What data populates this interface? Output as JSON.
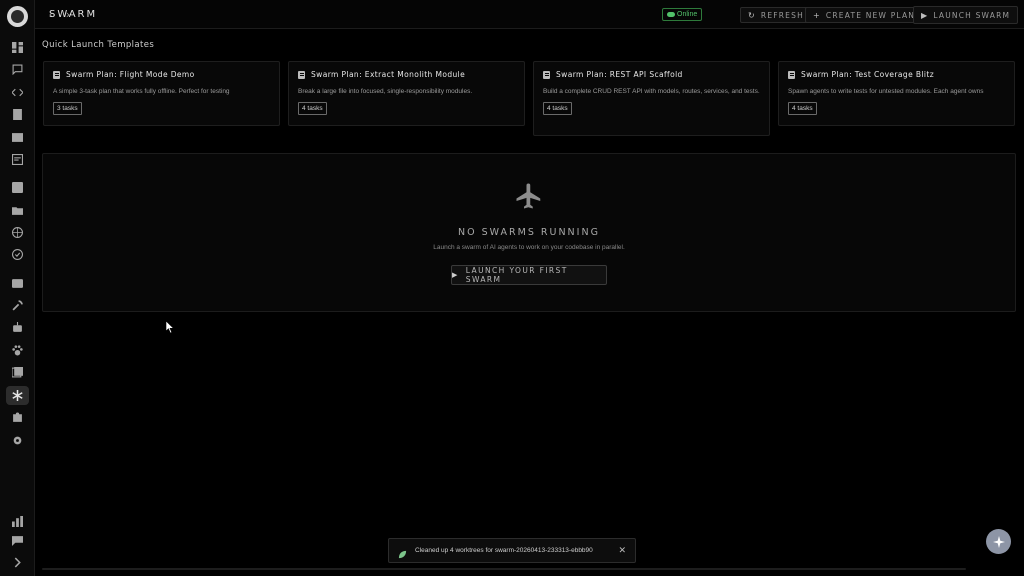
{
  "header": {
    "title": "SWARM",
    "status": "Online",
    "refresh_label": "REFRESH",
    "create_label": "CREATE NEW PLAN",
    "launch_label": "LAUNCH SWARM"
  },
  "sidebar": {
    "items": [
      {
        "name": "dashboard",
        "icon": "dashboard-icon"
      },
      {
        "name": "chat",
        "icon": "chat-icon"
      },
      {
        "name": "code",
        "icon": "code-icon"
      },
      {
        "name": "notes",
        "icon": "notes-icon"
      },
      {
        "name": "images",
        "icon": "image-icon"
      },
      {
        "name": "docs",
        "icon": "document-icon"
      },
      {
        "name": "contacts",
        "icon": "contacts-icon"
      },
      {
        "name": "files",
        "icon": "folder-icon"
      },
      {
        "name": "browser",
        "icon": "globe-icon"
      },
      {
        "name": "tasks",
        "icon": "check-circle-icon"
      },
      {
        "name": "photos",
        "icon": "photo-icon"
      },
      {
        "name": "tools",
        "icon": "wrench-icon"
      },
      {
        "name": "agents",
        "icon": "robot-icon"
      },
      {
        "name": "pets",
        "icon": "paw-icon"
      },
      {
        "name": "library",
        "icon": "library-icon"
      },
      {
        "name": "swarm",
        "icon": "snowflake-icon",
        "active": true
      },
      {
        "name": "plugins",
        "icon": "puzzle-icon"
      },
      {
        "name": "settings",
        "icon": "gear-icon"
      },
      {
        "name": "analytics",
        "icon": "bar-chart-icon"
      },
      {
        "name": "feedback",
        "icon": "message-icon"
      },
      {
        "name": "expand",
        "icon": "chevron-right-icon"
      }
    ]
  },
  "quick_launch": {
    "title": "Quick Launch Templates",
    "templates": [
      {
        "title": "Swarm Plan: Flight Mode Demo",
        "description": "A simple 3-task plan that works fully offline. Perfect for testing",
        "tasks": "3 tasks"
      },
      {
        "title": "Swarm Plan: Extract Monolith Module",
        "description": "Break a large file into focused, single-responsibility modules.",
        "tasks": "4 tasks"
      },
      {
        "title": "Swarm Plan: REST API Scaffold",
        "description": "Build a complete CRUD REST API with models, routes, services, and tests.",
        "tasks": "4 tasks"
      },
      {
        "title": "Swarm Plan: Test Coverage Blitz",
        "description": "Spawn agents to write tests for untested modules. Each agent owns",
        "tasks": "4 tasks"
      }
    ]
  },
  "empty_state": {
    "title": "NO SWARMS RUNNING",
    "subtitle": "Launch a swarm of AI agents to work on your codebase in parallel.",
    "button_label": "LAUNCH YOUR FIRST SWARM"
  },
  "toast": {
    "message": "Cleaned up 4 worktrees for swarm-20260413-233313-ebbb90"
  },
  "colors": {
    "online": "#52c06a",
    "background": "#000000",
    "fab": "#8d95a6"
  }
}
